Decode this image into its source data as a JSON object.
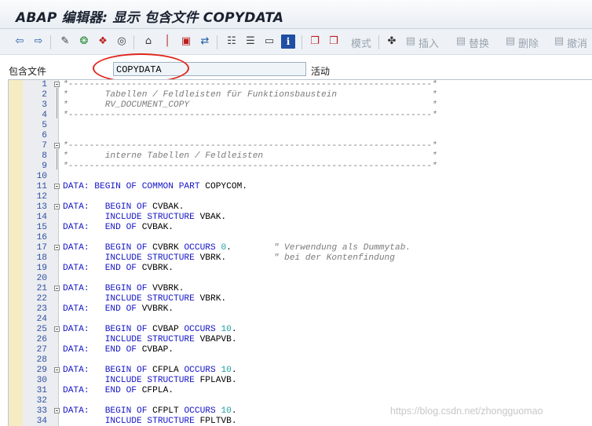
{
  "window": {
    "title": "ABAP 编辑器: 显示 包含文件 COPYDATA"
  },
  "toolbar": {
    "mode_label": "模式",
    "insert_label": "插入",
    "replace_label": "替换",
    "delete_label": "删除",
    "undo_label": "撤消"
  },
  "include_field": {
    "label": "包含文件",
    "value": "COPYDATA",
    "status": "活动"
  },
  "editor": {
    "lines": [
      {
        "n": "1",
        "t": "*---------------------------------------------------------------------*",
        "c": "cm",
        "fold": "open"
      },
      {
        "n": "2",
        "t": "*       Tabellen / Feldleisten für Funktionsbaustein                  *",
        "c": "cm"
      },
      {
        "n": "3",
        "t": "*       RV_DOCUMENT_COPY                                              *",
        "c": "cm"
      },
      {
        "n": "4",
        "t": "*---------------------------------------------------------------------*",
        "c": "cm"
      },
      {
        "n": "5",
        "t": ""
      },
      {
        "n": "6",
        "t": ""
      },
      {
        "n": "7",
        "t": "*---------------------------------------------------------------------*",
        "c": "cm",
        "fold": "open"
      },
      {
        "n": "8",
        "t": "*       interne Tabellen / Feldleisten                                *",
        "c": "cm"
      },
      {
        "n": "9",
        "t": "*---------------------------------------------------------------------*",
        "c": "cm"
      },
      {
        "n": "10",
        "t": ""
      },
      {
        "n": "11",
        "segs": [
          [
            "DATA: BEGIN OF COMMON PART ",
            "kw"
          ],
          [
            "COPYCOM.",
            ""
          ]
        ],
        "fold": "open"
      },
      {
        "n": "12",
        "t": ""
      },
      {
        "n": "13",
        "segs": [
          [
            "DATA:   BEGIN OF ",
            "kw"
          ],
          [
            "CVBAK.",
            ""
          ]
        ],
        "fold": "open"
      },
      {
        "n": "14",
        "segs": [
          [
            "        INCLUDE STRUCTURE ",
            "kw"
          ],
          [
            "VBAK.",
            ""
          ]
        ]
      },
      {
        "n": "15",
        "segs": [
          [
            "DATA:   END OF ",
            "kw"
          ],
          [
            "CVBAK.",
            ""
          ]
        ]
      },
      {
        "n": "16",
        "t": ""
      },
      {
        "n": "17",
        "segs": [
          [
            "DATA:   BEGIN OF ",
            "kw"
          ],
          [
            "CVBRK ",
            ""
          ],
          [
            "OCCURS ",
            "kw"
          ],
          [
            "0",
            "num"
          ],
          [
            ".        ",
            ""
          ],
          [
            "\" Verwendung als Dummytab.",
            "cm"
          ]
        ],
        "fold": "open"
      },
      {
        "n": "18",
        "segs": [
          [
            "        INCLUDE STRUCTURE ",
            "kw"
          ],
          [
            "VBRK.         ",
            ""
          ],
          [
            "\" bei der Kontenfindung",
            "cm"
          ]
        ]
      },
      {
        "n": "19",
        "segs": [
          [
            "DATA:   END OF ",
            "kw"
          ],
          [
            "CVBRK.",
            ""
          ]
        ]
      },
      {
        "n": "20",
        "t": ""
      },
      {
        "n": "21",
        "segs": [
          [
            "DATA:   BEGIN OF ",
            "kw"
          ],
          [
            "VVBRK.",
            ""
          ]
        ],
        "fold": "open"
      },
      {
        "n": "22",
        "segs": [
          [
            "        INCLUDE STRUCTURE ",
            "kw"
          ],
          [
            "VBRK.",
            ""
          ]
        ]
      },
      {
        "n": "23",
        "segs": [
          [
            "DATA:   END OF ",
            "kw"
          ],
          [
            "VVBRK.",
            ""
          ]
        ]
      },
      {
        "n": "24",
        "t": ""
      },
      {
        "n": "25",
        "segs": [
          [
            "DATA:   BEGIN OF ",
            "kw"
          ],
          [
            "CVBAP ",
            ""
          ],
          [
            "OCCURS ",
            "kw"
          ],
          [
            "10",
            "num"
          ],
          [
            ".",
            ""
          ]
        ],
        "fold": "open"
      },
      {
        "n": "26",
        "segs": [
          [
            "        INCLUDE STRUCTURE ",
            "kw"
          ],
          [
            "VBAPVB.",
            ""
          ]
        ]
      },
      {
        "n": "27",
        "segs": [
          [
            "DATA:   END OF ",
            "kw"
          ],
          [
            "CVBAP.",
            ""
          ]
        ]
      },
      {
        "n": "28",
        "t": ""
      },
      {
        "n": "29",
        "segs": [
          [
            "DATA:   BEGIN OF ",
            "kw"
          ],
          [
            "CFPLA ",
            ""
          ],
          [
            "OCCURS ",
            "kw"
          ],
          [
            "10",
            "num"
          ],
          [
            ".",
            ""
          ]
        ],
        "fold": "open"
      },
      {
        "n": "30",
        "segs": [
          [
            "        INCLUDE STRUCTURE ",
            "kw"
          ],
          [
            "FPLAVB.",
            ""
          ]
        ]
      },
      {
        "n": "31",
        "segs": [
          [
            "DATA:   END OF ",
            "kw"
          ],
          [
            "CFPLA.",
            ""
          ]
        ]
      },
      {
        "n": "32",
        "t": ""
      },
      {
        "n": "33",
        "segs": [
          [
            "DATA:   BEGIN OF ",
            "kw"
          ],
          [
            "CFPLT ",
            ""
          ],
          [
            "OCCURS ",
            "kw"
          ],
          [
            "10",
            "num"
          ],
          [
            ".",
            ""
          ]
        ],
        "fold": "open"
      },
      {
        "n": "34",
        "segs": [
          [
            "        INCLUDE STRUCTURE ",
            "kw"
          ],
          [
            "FPLTVB.",
            ""
          ]
        ]
      }
    ]
  },
  "watermark": "https://blog.csdn.net/zhongguomao",
  "colors": {
    "keyword": "#1515c8",
    "comment": "#7c7c7c",
    "number": "#20a0a0",
    "annotation_oval": "#e0261c"
  }
}
